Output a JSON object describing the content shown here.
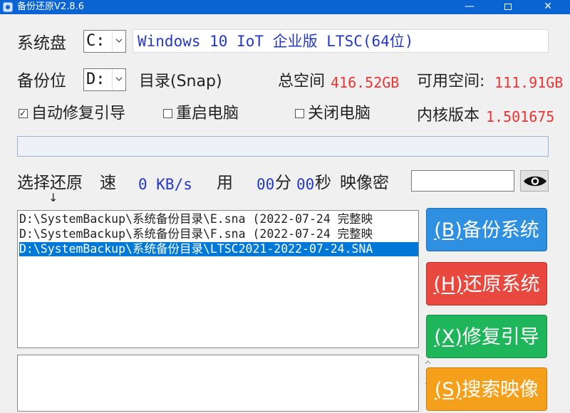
{
  "window": {
    "title": "备份还原V2.8.6",
    "controls": {
      "minimize": "—",
      "close": "✕"
    }
  },
  "system_disk": {
    "label": "系统盘",
    "value": "C:",
    "os_info": "Windows 10 IoT 企业版 LTSC(64位)"
  },
  "backup_location": {
    "label": "备份位",
    "value": "D:",
    "dir_label": "目录(Snap)",
    "total_label": "总空间",
    "total_value": "416.52GB",
    "free_label": "可用空间:",
    "free_value": "111.91GB"
  },
  "options": {
    "auto_repair": {
      "label": "自动修复引导",
      "checked": true,
      "mark": "✓"
    },
    "restart": {
      "label": "重启电脑",
      "checked": false
    },
    "shutdown": {
      "label": "关闭电脑",
      "checked": false
    },
    "kernel_label": "内核版本",
    "kernel_value": "1.501675"
  },
  "progress": {
    "value": 0
  },
  "status": {
    "select_label": "选择还原",
    "speed_label": "速",
    "speed_value": "0 KB/s",
    "used_label": "用",
    "minutes": "00",
    "minutes_unit": "分",
    "seconds": "00",
    "seconds_unit": "秒",
    "password_label": "映像密",
    "arrow": "↓"
  },
  "images": [
    {
      "text": "D:\\SystemBackup\\系统备份目录\\E.sna (2022-07-24 完整映",
      "selected": false
    },
    {
      "text": "D:\\SystemBackup\\系统备份目录\\F.sna (2022-07-24 完整映",
      "selected": false
    },
    {
      "text": "D:\\SystemBackup\\系统备份目录\\LTSC2021-2022-07-24.SNA",
      "selected": true
    }
  ],
  "buttons": {
    "backup": {
      "key": "(B)",
      "text": "备份系统",
      "color": "#2f8fe0"
    },
    "restore": {
      "key": "(H)",
      "text": "还原系统",
      "color": "#e8483e"
    },
    "repair": {
      "key": "(X)",
      "text": "修复引导",
      "color": "#1fb55a"
    },
    "search": {
      "key": "(S)",
      "text": "搜索映像",
      "color": "#f5a01a"
    }
  },
  "icons": {
    "eye": "eye-icon",
    "app": "app-icon"
  }
}
